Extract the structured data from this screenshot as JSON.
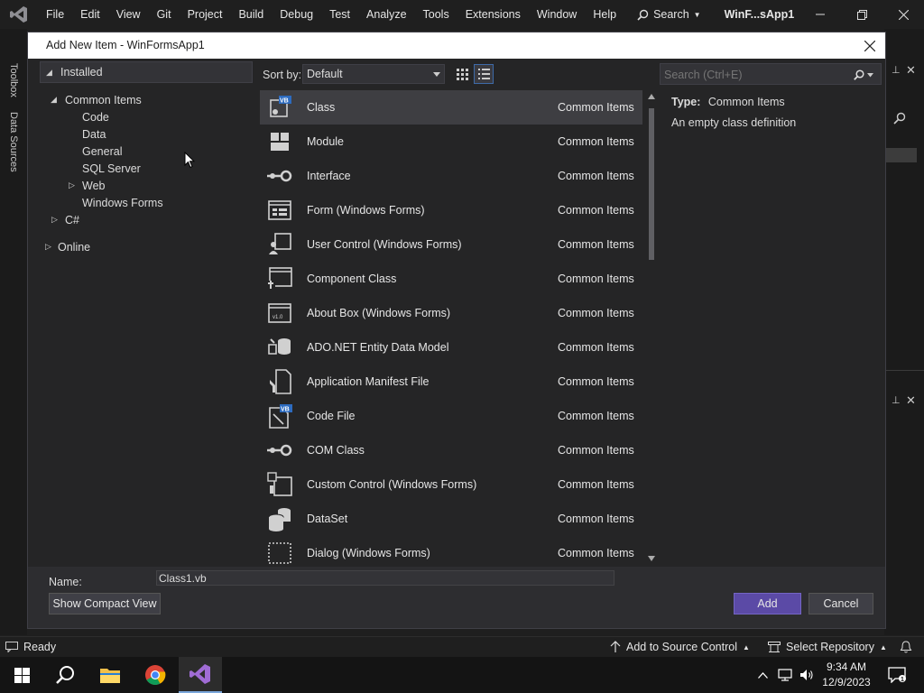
{
  "menubar": {
    "items": [
      "File",
      "Edit",
      "View",
      "Git",
      "Project",
      "Build",
      "Debug",
      "Test",
      "Analyze",
      "Tools",
      "Extensions",
      "Window",
      "Help"
    ],
    "search_label": "Search",
    "solution_name": "WinF...sApp1"
  },
  "side_tabs": {
    "toolbox": "Toolbox",
    "data_sources": "Data Sources"
  },
  "dialog": {
    "title": "Add New Item - WinFormsApp1",
    "tree": {
      "installed": "Installed",
      "common_items": "Common Items",
      "code": "Code",
      "data": "Data",
      "general": "General",
      "sql_server": "SQL Server",
      "web": "Web",
      "windows_forms": "Windows Forms",
      "csharp": "C#",
      "online": "Online"
    },
    "sort_label": "Sort by:",
    "sort_value": "Default",
    "search_placeholder": "Search (Ctrl+E)",
    "items": [
      {
        "name": "Class",
        "category": "Common Items",
        "icon": "class-icon"
      },
      {
        "name": "Module",
        "category": "Common Items",
        "icon": "module-icon"
      },
      {
        "name": "Interface",
        "category": "Common Items",
        "icon": "interface-icon"
      },
      {
        "name": "Form (Windows Forms)",
        "category": "Common Items",
        "icon": "form-icon"
      },
      {
        "name": "User Control (Windows Forms)",
        "category": "Common Items",
        "icon": "user-control-icon"
      },
      {
        "name": "Component Class",
        "category": "Common Items",
        "icon": "component-icon"
      },
      {
        "name": "About Box (Windows Forms)",
        "category": "Common Items",
        "icon": "about-box-icon"
      },
      {
        "name": "ADO.NET Entity Data Model",
        "category": "Common Items",
        "icon": "entity-model-icon"
      },
      {
        "name": "Application Manifest File",
        "category": "Common Items",
        "icon": "manifest-icon"
      },
      {
        "name": "Code File",
        "category": "Common Items",
        "icon": "code-file-icon"
      },
      {
        "name": "COM Class",
        "category": "Common Items",
        "icon": "com-class-icon"
      },
      {
        "name": "Custom Control (Windows Forms)",
        "category": "Common Items",
        "icon": "custom-control-icon"
      },
      {
        "name": "DataSet",
        "category": "Common Items",
        "icon": "dataset-icon"
      },
      {
        "name": "Dialog (Windows Forms)",
        "category": "Common Items",
        "icon": "dialog-icon"
      }
    ],
    "selected_index": 0,
    "description": {
      "type_label": "Type:",
      "type_value": "Common Items",
      "text": "An empty class definition"
    },
    "name_label": "Name:",
    "name_value": "Class1.vb",
    "compact_button": "Show Compact View",
    "add_button": "Add",
    "cancel_button": "Cancel"
  },
  "statusbar": {
    "ready": "Ready",
    "source_control": "Add to Source Control",
    "repository": "Select Repository"
  },
  "taskbar": {
    "time": "9:34 AM",
    "date": "12/9/2023"
  },
  "colors": {
    "accent": "#5b4aa6",
    "background": "#1f1f1f",
    "dialog": "#252526"
  }
}
